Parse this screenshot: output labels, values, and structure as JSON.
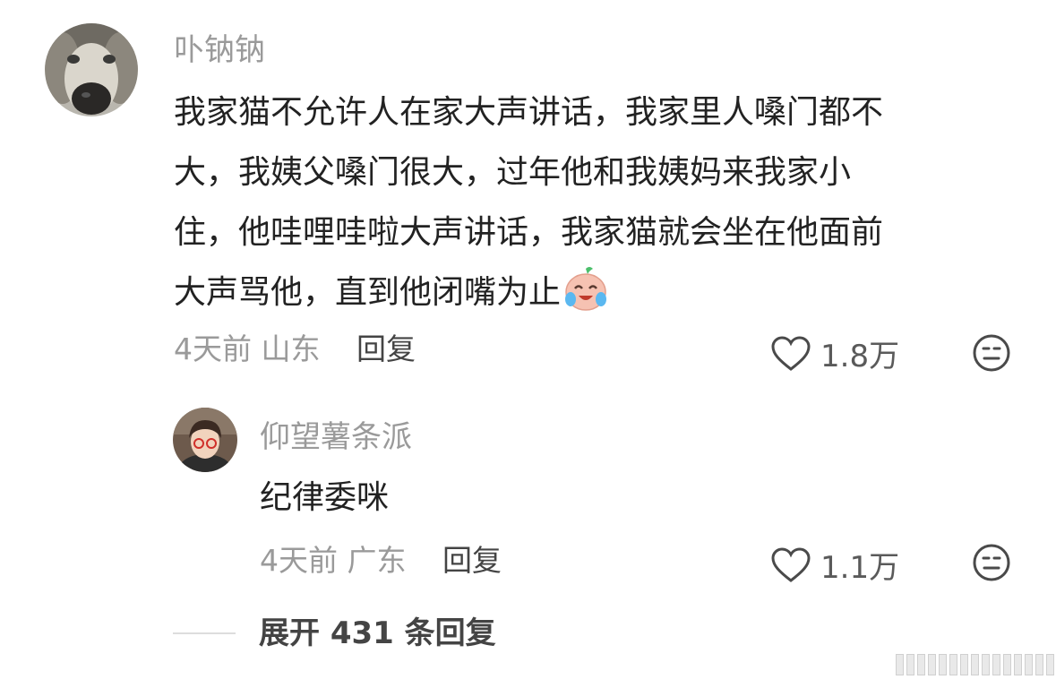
{
  "comment": {
    "author": "卟钠钠",
    "lines": [
      "我家猫不允许人在家大声讲话，我家里人嗓门都不",
      "大，我姨父嗓门很大，过年他和我姨妈来我家小",
      "住，他哇哩哇啦大声讲话，我家猫就会坐在他面前",
      "大声骂他，直到他闭嘴为止"
    ],
    "emoji_icon": "laughing-crying-emoji",
    "time": "4天前",
    "location": "山东",
    "reply_label": "回复",
    "likes": "1.8万"
  },
  "reply": {
    "author": "仰望薯条派",
    "text": "纪律委咪",
    "time": "4天前",
    "location": "广东",
    "reply_label": "回复",
    "likes": "1.1万"
  },
  "expand_label": "展开 431 条回复",
  "colors": {
    "name": "#9a9a9a",
    "text": "#222222",
    "meta": "#9a9a9a"
  }
}
